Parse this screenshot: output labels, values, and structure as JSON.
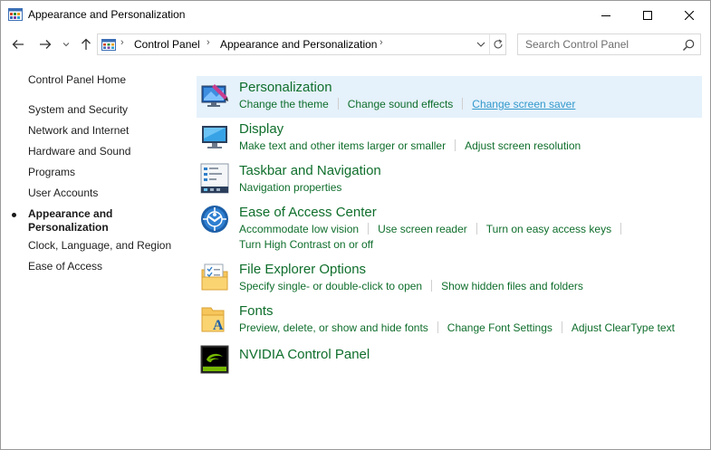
{
  "window": {
    "title": "Appearance and Personalization"
  },
  "address": {
    "crumbs": [
      "Control Panel",
      "Appearance and Personalization"
    ]
  },
  "search": {
    "placeholder": "Search Control Panel"
  },
  "left_nav": {
    "home": "Control Panel Home",
    "items": [
      "System and Security",
      "Network and Internet",
      "Hardware and Sound",
      "Programs",
      "User Accounts"
    ],
    "current_line1": "Appearance and",
    "current_line2": "Personalization",
    "items_after": [
      "Clock, Language, and Region",
      "Ease of Access"
    ]
  },
  "categories": [
    {
      "title": "Personalization",
      "icon": "personalization-icon",
      "links": [
        "Change the theme",
        "Change sound effects",
        "Change screen saver"
      ]
    },
    {
      "title": "Display",
      "icon": "display-icon",
      "links": [
        "Make text and other items larger or smaller",
        "Adjust screen resolution"
      ]
    },
    {
      "title": "Taskbar and Navigation",
      "icon": "taskbar-icon",
      "links": [
        "Navigation properties"
      ]
    },
    {
      "title": "Ease of Access Center",
      "icon": "ease-of-access-icon",
      "links": [
        "Accommodate low vision",
        "Use screen reader",
        "Turn on easy access keys",
        "Turn High Contrast on or off"
      ]
    },
    {
      "title": "File Explorer Options",
      "icon": "folder-options-icon",
      "links": [
        "Specify single- or double-click to open",
        "Show hidden files and folders"
      ]
    },
    {
      "title": "Fonts",
      "icon": "fonts-icon",
      "links": [
        "Preview, delete, or show and hide fonts",
        "Change Font Settings",
        "Adjust ClearType text"
      ]
    },
    {
      "title": "NVIDIA Control Panel",
      "icon": "nvidia-icon",
      "links": []
    }
  ],
  "colors": {
    "link_green": "#0f6e2c",
    "hover_blue": "#3399cc",
    "highlight_bg": "#e5f1fb"
  }
}
